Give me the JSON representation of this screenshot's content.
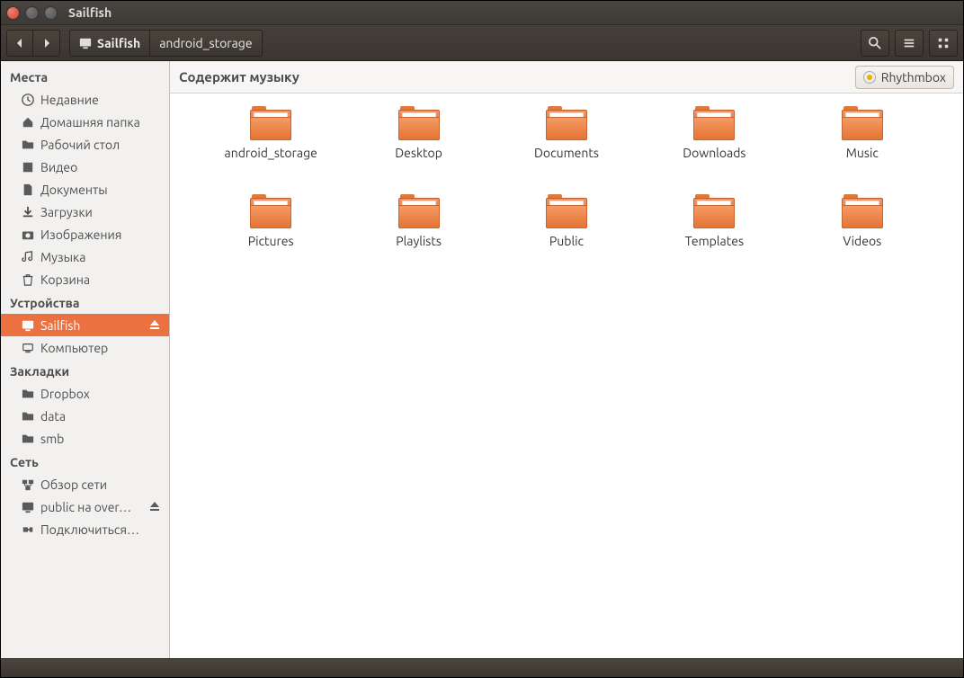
{
  "window": {
    "title": "Sailfish"
  },
  "breadcrumbs": {
    "root": "Sailfish",
    "current": "android_storage"
  },
  "sidebar": {
    "places": {
      "header": "Места",
      "items": [
        {
          "key": "recent",
          "label": "Недавние"
        },
        {
          "key": "home",
          "label": "Домашняя папка"
        },
        {
          "key": "desktop",
          "label": "Рабочий стол"
        },
        {
          "key": "videos",
          "label": "Видео"
        },
        {
          "key": "documents",
          "label": "Документы"
        },
        {
          "key": "downloads",
          "label": "Загрузки"
        },
        {
          "key": "pictures",
          "label": "Изображения"
        },
        {
          "key": "music",
          "label": "Музыка"
        },
        {
          "key": "trash",
          "label": "Корзина"
        }
      ]
    },
    "devices": {
      "header": "Устройства",
      "items": [
        {
          "key": "sailfish",
          "label": "Sailfish",
          "active": true,
          "eject": true
        },
        {
          "key": "computer",
          "label": "Компьютер"
        }
      ]
    },
    "bookmarks": {
      "header": "Закладки",
      "items": [
        {
          "key": "dropbox",
          "label": "Dropbox"
        },
        {
          "key": "data",
          "label": "data"
        },
        {
          "key": "smb",
          "label": "smb"
        }
      ]
    },
    "network": {
      "header": "Сеть",
      "items": [
        {
          "key": "browse",
          "label": "Обзор сети"
        },
        {
          "key": "public",
          "label": "public на over…",
          "eject": true
        },
        {
          "key": "connect",
          "label": "Подключиться…"
        }
      ]
    }
  },
  "info": {
    "label": "Содержит музыку",
    "app_button": "Rhythmbox"
  },
  "folders": [
    {
      "name": "android_storage"
    },
    {
      "name": "Desktop"
    },
    {
      "name": "Documents"
    },
    {
      "name": "Downloads"
    },
    {
      "name": "Music"
    },
    {
      "name": "Pictures"
    },
    {
      "name": "Playlists"
    },
    {
      "name": "Public"
    },
    {
      "name": "Templates"
    },
    {
      "name": "Videos"
    }
  ]
}
